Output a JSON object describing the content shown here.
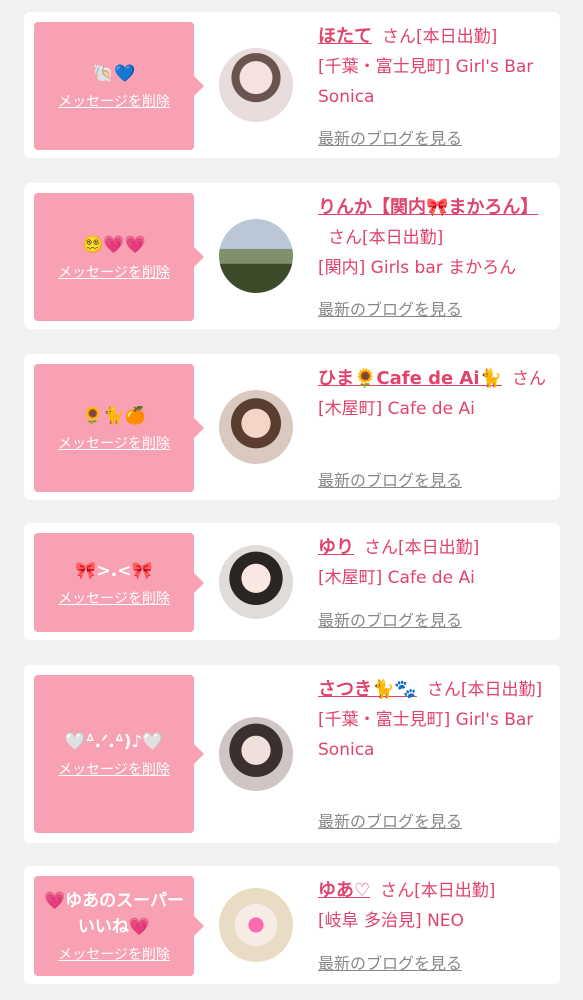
{
  "common": {
    "delete_label": "メッセージを削除",
    "san": "さん",
    "blog_label": "最新のブログを見る"
  },
  "colors": {
    "accent": "#e0436b",
    "bubble": "#f7a1b3",
    "link_gray": "#888888"
  },
  "cards": [
    {
      "message": "🐚💙",
      "name": "ほたて",
      "status": "[本日出勤]",
      "shop": "[千葉・富士見町] Girl's Bar Sonica"
    },
    {
      "message": "😵‍💫💗💗",
      "name": "りんか【関内🎀まかろん】",
      "status": "[本日出勤]",
      "shop": "[関内] Girls bar まかろん"
    },
    {
      "message": "🌻🐈🍊",
      "name": "ひま🌻Cafe de Ai🐈",
      "status": "",
      "shop": "[木屋町] Cafe de Ai"
    },
    {
      "message": "🎀>.<🎀",
      "name": "ゆり",
      "status": "[本日出勤]",
      "shop": "[木屋町] Cafe de Ai"
    },
    {
      "message": "🤍ᐞ.ᐟ.ᐞ)♪🤍",
      "name": "さつき🐈🐾",
      "status": "[本日出勤]",
      "shop": "[千葉・富士見町] Girl's Bar Sonica"
    },
    {
      "message": "💗ゆあのスーパーいいね💗",
      "name": "ゆあ♡",
      "status": "[本日出勤]",
      "shop": "[岐阜 多治見] NEO"
    }
  ]
}
